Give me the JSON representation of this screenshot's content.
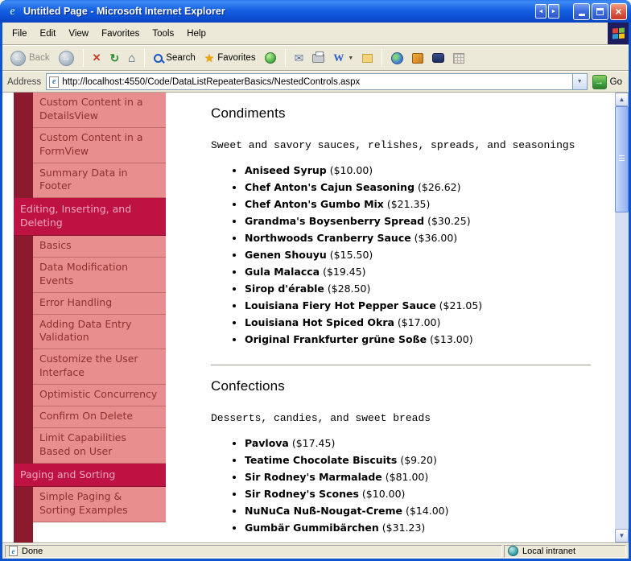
{
  "window": {
    "title": "Untitled Page - Microsoft Internet Explorer"
  },
  "menu": {
    "items": [
      "File",
      "Edit",
      "View",
      "Favorites",
      "Tools",
      "Help"
    ]
  },
  "toolbar": {
    "back_label": "Back",
    "search_label": "Search",
    "favorites_label": "Favorites"
  },
  "address": {
    "label": "Address",
    "url": "http://localhost:4550/Code/DataListRepeaterBasics/NestedControls.aspx",
    "go_label": "Go"
  },
  "icons": {
    "e": "e",
    "caption_left": "◄",
    "caption_right": "►",
    "close": "×",
    "back_arrow": "←",
    "forward_arrow": "→",
    "stop": "✕",
    "refresh": "↻",
    "home": "⌂",
    "star": "★",
    "mail": "✉",
    "word": "W",
    "dropdown": "▼",
    "go_arrow": "→",
    "up_arrow": "▲",
    "down_arrow": "▼"
  },
  "sidebar": {
    "items": [
      {
        "label": "Custom Content in a DetailsView",
        "type": "child"
      },
      {
        "label": "Custom Content in a FormView",
        "type": "child"
      },
      {
        "label": "Summary Data in Footer",
        "type": "child"
      },
      {
        "label": "Editing, Inserting, and Deleting",
        "type": "header"
      },
      {
        "label": "Basics",
        "type": "child"
      },
      {
        "label": "Data Modification Events",
        "type": "child"
      },
      {
        "label": "Error Handling",
        "type": "child"
      },
      {
        "label": "Adding Data Entry Validation",
        "type": "child"
      },
      {
        "label": "Customize the User Interface",
        "type": "child"
      },
      {
        "label": "Optimistic Concurrency",
        "type": "child"
      },
      {
        "label": "Confirm On Delete",
        "type": "child"
      },
      {
        "label": "Limit Capabilities Based on User",
        "type": "child"
      },
      {
        "label": "Paging and Sorting",
        "type": "header"
      },
      {
        "label": "Simple Paging & Sorting Examples",
        "type": "child"
      }
    ]
  },
  "main": {
    "sections": [
      {
        "title": "Condiments",
        "description": "Sweet and savory sauces, relishes, spreads, and seasonings",
        "products": [
          {
            "name": "Aniseed Syrup",
            "price": "($10.00)"
          },
          {
            "name": "Chef Anton's Cajun Seasoning",
            "price": "($26.62)"
          },
          {
            "name": "Chef Anton's Gumbo Mix",
            "price": "($21.35)"
          },
          {
            "name": "Grandma's Boysenberry Spread",
            "price": "($30.25)"
          },
          {
            "name": "Northwoods Cranberry Sauce",
            "price": "($36.00)"
          },
          {
            "name": "Genen Shouyu",
            "price": "($15.50)"
          },
          {
            "name": "Gula Malacca",
            "price": "($19.45)"
          },
          {
            "name": "Sirop d'érable",
            "price": "($28.50)"
          },
          {
            "name": "Louisiana Fiery Hot Pepper Sauce",
            "price": "($21.05)"
          },
          {
            "name": "Louisiana Hot Spiced Okra",
            "price": "($17.00)"
          },
          {
            "name": "Original Frankfurter grüne Soße",
            "price": "($13.00)"
          }
        ]
      },
      {
        "title": "Confections",
        "description": "Desserts, candies, and sweet breads",
        "products": [
          {
            "name": "Pavlova",
            "price": "($17.45)"
          },
          {
            "name": "Teatime Chocolate Biscuits",
            "price": "($9.20)"
          },
          {
            "name": "Sir Rodney's Marmalade",
            "price": "($81.00)"
          },
          {
            "name": "Sir Rodney's Scones",
            "price": "($10.00)"
          },
          {
            "name": "NuNuCa Nuß-Nougat-Creme",
            "price": "($14.00)"
          },
          {
            "name": "Gumbär Gummibärchen",
            "price": "($31.23)"
          }
        ]
      }
    ]
  },
  "status": {
    "left": "Done",
    "zone": "Local intranet"
  },
  "colors": {
    "titlebar_blue": "#0D54D1",
    "chrome_bg": "#ECE9D8",
    "nav_strip": "#8C1A2E",
    "nav_item_bg": "#E88E8E",
    "nav_item_text": "#8E3030",
    "nav_header_bg": "#BE1243",
    "nav_header_text": "#F2A9BC"
  }
}
